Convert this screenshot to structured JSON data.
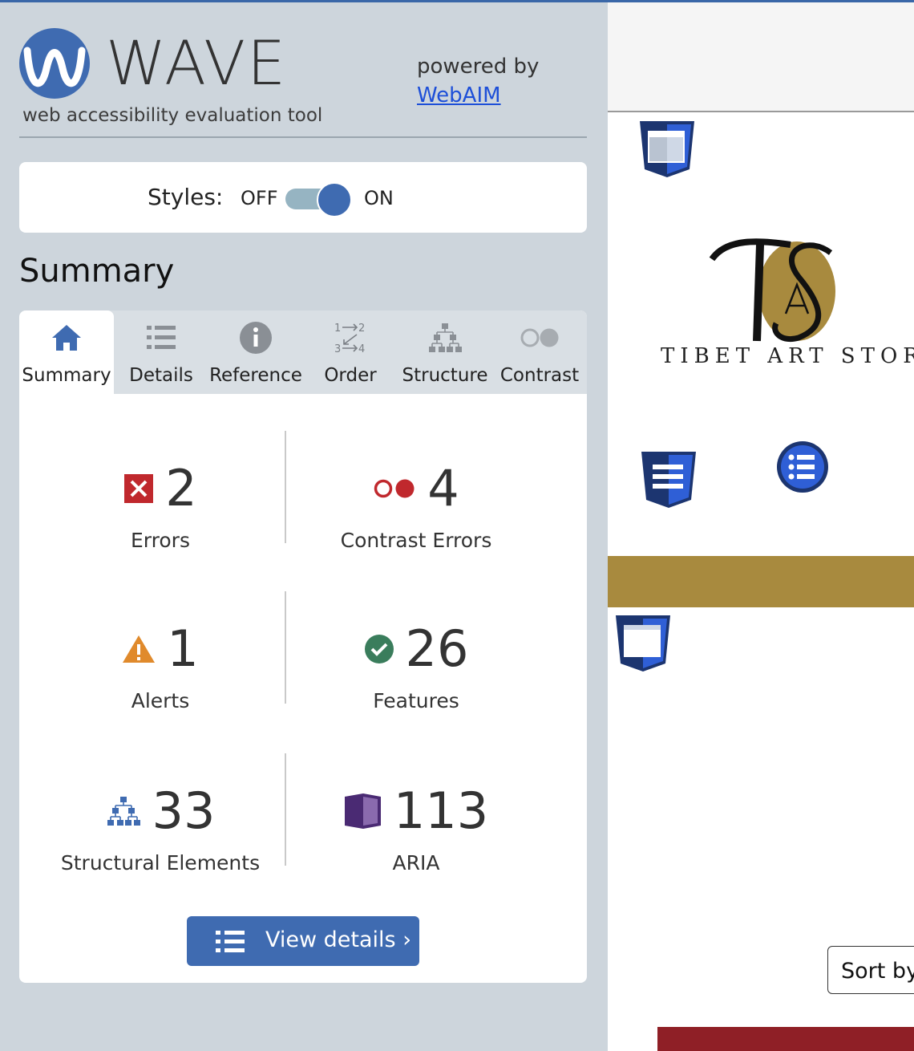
{
  "app": {
    "name": "WAVE",
    "tagline": "web accessibility evaluation tool",
    "powered_by": "powered by",
    "powered_by_link": "WebAIM"
  },
  "styles_toggle": {
    "label": "Styles:",
    "off": "OFF",
    "on": "ON",
    "state": "on"
  },
  "summary_heading": "Summary",
  "tabs": [
    {
      "label": "Summary",
      "icon": "home-icon",
      "active": true
    },
    {
      "label": "Details",
      "icon": "list-icon",
      "active": false
    },
    {
      "label": "Reference",
      "icon": "info-icon",
      "active": false
    },
    {
      "label": "Order",
      "icon": "order-icon",
      "active": false
    },
    {
      "label": "Structure",
      "icon": "structure-icon",
      "active": false
    },
    {
      "label": "Contrast",
      "icon": "contrast-icon",
      "active": false
    }
  ],
  "stats": {
    "errors": {
      "count": "2",
      "label": "Errors",
      "icon": "error-icon"
    },
    "contrast_errors": {
      "count": "4",
      "label": "Contrast Errors",
      "icon": "contrast-error-icon"
    },
    "alerts": {
      "count": "1",
      "label": "Alerts",
      "icon": "alert-icon"
    },
    "features": {
      "count": "26",
      "label": "Features",
      "icon": "feature-icon"
    },
    "structural": {
      "count": "33",
      "label": "Structural Elements",
      "icon": "structure-icon"
    },
    "aria": {
      "count": "113",
      "label": "ARIA",
      "icon": "aria-icon"
    }
  },
  "view_details_button": "View details ›",
  "preview": {
    "store_name": "TIBET ART STOR",
    "logo_letters": "TSA",
    "sort_label": "Sort by"
  },
  "colors": {
    "brand_blue": "#3f6bb1",
    "sidebar_bg": "#cdd5dc",
    "error_red": "#c0282d",
    "alert_orange": "#e08a2c",
    "feature_green": "#3a7d5c",
    "aria_purple": "#4a2a73",
    "gold": "#a88a3e"
  }
}
